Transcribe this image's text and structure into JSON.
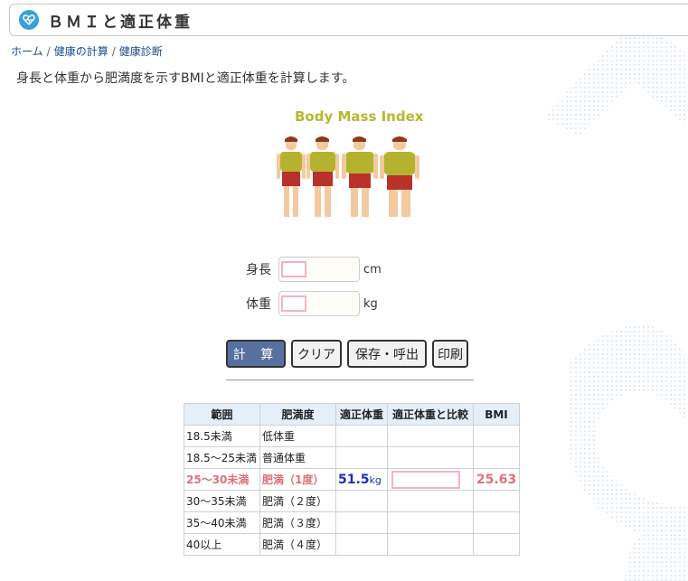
{
  "header": {
    "title": "ＢＭＩと適正体重"
  },
  "breadcrumb": {
    "items": [
      "ホーム",
      "健康の計算",
      "健康診断"
    ]
  },
  "description": "身長と体重から肥満度を示すBMIと適正体重を計算します。",
  "hero": {
    "title": "Body Mass Index"
  },
  "form": {
    "height": {
      "label": "身長",
      "unit": "cm",
      "value": ""
    },
    "weight": {
      "label": "体重",
      "unit": "kg",
      "value": ""
    }
  },
  "buttons": {
    "calc": "計 算",
    "clear": "クリア",
    "save": "保存・呼出",
    "print": "印刷"
  },
  "table": {
    "headers": [
      "範囲",
      "肥満度",
      "適正体重",
      "適正体重と比較",
      "BMI"
    ],
    "rows": [
      {
        "range": "18.5未満",
        "level": "低体重"
      },
      {
        "range": "18.5～25未満",
        "level": "普通体重"
      },
      {
        "range": "25～30未満",
        "level": "肥満（1度）"
      },
      {
        "range": "30～35未満",
        "level": "肥満（２度）"
      },
      {
        "range": "35～40未満",
        "level": "肥満（３度）"
      },
      {
        "range": "40以上",
        "level": "肥満（４度）"
      }
    ],
    "result": {
      "std_weight": "51.5",
      "std_weight_unit": "kg",
      "bmi": "25.63"
    }
  },
  "colors": {
    "accent": "#5870a0",
    "highlight": "#e0707a",
    "bmi": "#e00000",
    "std_weight": "#1a2fbf",
    "header_bg": "#e4effa"
  }
}
